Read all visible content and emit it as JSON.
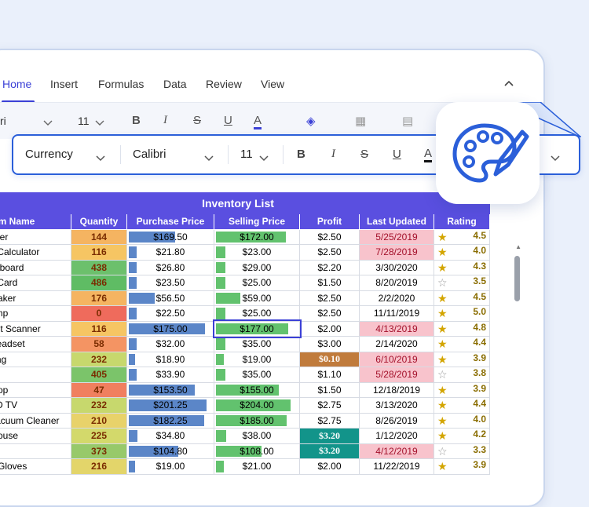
{
  "tabs": [
    {
      "label": "Home",
      "active": true
    },
    {
      "label": "Insert"
    },
    {
      "label": "Formulas"
    },
    {
      "label": "Data"
    },
    {
      "label": "Review"
    },
    {
      "label": "View"
    }
  ],
  "toolbar": {
    "font_clip": "ri",
    "size": "11"
  },
  "floating_toolbar": {
    "format": "Currency",
    "font": "Calibri",
    "size": "11"
  },
  "sheet": {
    "title": "Inventory List",
    "headers": [
      "tem Name",
      "Quantity",
      "Purchase Price",
      "Selling Price",
      "Profit",
      "Last Updated",
      "Rating"
    ],
    "rows": [
      {
        "name": "inter",
        "qty": "144",
        "qtyColor": "#f5b461",
        "pp": "$169.50",
        "ppFrac": 0.6,
        "sp": "$172.00",
        "spFrac": 0.92,
        "profit": "$2.50",
        "date": "5/25/2019",
        "dateColor": "#f8c3cc",
        "star": "full",
        "rating": "4.5"
      },
      {
        "name": "c Calculator",
        "qty": "116",
        "qtyColor": "#f6c563",
        "pp": "$21.80",
        "ppFrac": 0.1,
        "sp": "$23.00",
        "spFrac": 0.12,
        "profit": "$2.50",
        "date": "7/28/2019",
        "dateColor": "#f8c3cc",
        "star": "full",
        "rating": "4.0"
      },
      {
        "name": "eyboard",
        "qty": "438",
        "qtyColor": "#6cc06c",
        "pp": "$26.80",
        "ppFrac": 0.1,
        "sp": "$29.00",
        "spFrac": 0.12,
        "profit": "$2.20",
        "date": "3/30/2020",
        "dateColor": "",
        "star": "full",
        "rating": "4.3"
      },
      {
        "name": "y Card",
        "qty": "486",
        "qtyColor": "#5fbc64",
        "pp": "$23.50",
        "ppFrac": 0.1,
        "sp": "$25.00",
        "spFrac": 0.12,
        "profit": "$1.50",
        "date": "8/20/2019",
        "dateColor": "",
        "star": "empty",
        "rating": "3.5"
      },
      {
        "name": "Maker",
        "qty": "176",
        "qtyColor": "#f5b461",
        "pp": "$56.50",
        "ppFrac": 0.33,
        "sp": "$59.00",
        "spFrac": 0.32,
        "profit": "$2.50",
        "date": "2/2/2020",
        "dateColor": "",
        "star": "full",
        "rating": "4.5"
      },
      {
        "name": "amp",
        "qty": "0",
        "qtyColor": "#ef6b5c",
        "pp": "$22.50",
        "ppFrac": 0.1,
        "sp": "$25.00",
        "spFrac": 0.12,
        "profit": "$2.50",
        "date": "11/11/2019",
        "dateColor": "",
        "star": "full",
        "rating": "5.0"
      },
      {
        "name": "ent Scanner",
        "qty": "116",
        "qtyColor": "#f6c563",
        "pp": "$175.00",
        "ppFrac": 0.98,
        "sp": "$177.00",
        "spFrac": 0.95,
        "profit": "$2.00",
        "date": "4/13/2019",
        "dateColor": "#f8c3cc",
        "star": "full",
        "rating": "4.8"
      },
      {
        "name": "Headset",
        "qty": "58",
        "qtyColor": "#f49463",
        "pp": "$32.00",
        "ppFrac": 0.1,
        "sp": "$35.00",
        "spFrac": 0.12,
        "profit": "$3.00",
        "date": "2/14/2020",
        "dateColor": "",
        "star": "full",
        "rating": "4.4"
      },
      {
        "name": "Bag",
        "qty": "232",
        "qtyColor": "#c7d86d",
        "pp": "$18.90",
        "ppFrac": 0.08,
        "sp": "$19.00",
        "spFrac": 0.1,
        "profit": "$0.10",
        "profitColor": "#c07b3c",
        "date": "6/10/2019",
        "dateColor": "#f8c3cc",
        "star": "full",
        "rating": "3.9"
      },
      {
        "name": "an",
        "qty": "405",
        "qtyColor": "#7bc46a",
        "pp": "$33.90",
        "ppFrac": 0.1,
        "sp": "$35.00",
        "spFrac": 0.12,
        "profit": "$1.10",
        "date": "5/28/2019",
        "dateColor": "#f8c3cc",
        "star": "empty",
        "rating": "3.8"
      },
      {
        "name": "Mop",
        "qty": "47",
        "qtyColor": "#f07f5f",
        "pp": "$153.50",
        "ppFrac": 0.85,
        "sp": "$155.00",
        "spFrac": 0.82,
        "profit": "$1.50",
        "date": "12/18/2019",
        "dateColor": "",
        "star": "full",
        "rating": "3.9"
      },
      {
        "name": "ED TV",
        "qty": "232",
        "qtyColor": "#c7d86d",
        "pp": "$201.25",
        "ppFrac": 1.0,
        "sp": "$204.00",
        "spFrac": 0.98,
        "profit": "$2.75",
        "date": "3/13/2020",
        "dateColor": "",
        "star": "full",
        "rating": "4.4"
      },
      {
        "name": "Vacuum Cleaner",
        "qty": "210",
        "qtyColor": "#e8d26a",
        "pp": "$182.25",
        "ppFrac": 0.97,
        "sp": "$185.00",
        "spFrac": 0.93,
        "profit": "$2.75",
        "date": "8/26/2019",
        "dateColor": "",
        "star": "full",
        "rating": "4.0"
      },
      {
        "name": "Mouse",
        "qty": "225",
        "qtyColor": "#d3d96b",
        "pp": "$34.80",
        "ppFrac": 0.11,
        "sp": "$38.00",
        "spFrac": 0.13,
        "profit": "$3.20",
        "profitColor": "#12948a",
        "date": "1/12/2020",
        "dateColor": "",
        "star": "full",
        "rating": "4.2"
      },
      {
        "name": "",
        "qty": "373",
        "qtyColor": "#97c96a",
        "pp": "$104.80",
        "ppFrac": 0.64,
        "sp": "$108.00",
        "spFrac": 0.6,
        "profit": "$3.20",
        "profitColor": "#12948a",
        "date": "4/12/2019",
        "dateColor": "#f8c3cc",
        "star": "empty",
        "rating": "3.3"
      },
      {
        "name": "g Gloves",
        "qty": "216",
        "qtyColor": "#e3d56a",
        "pp": "$19.00",
        "ppFrac": 0.08,
        "sp": "$21.00",
        "spFrac": 0.1,
        "profit": "$2.00",
        "date": "11/22/2019",
        "dateColor": "",
        "star": "full",
        "rating": "3.9"
      }
    ]
  }
}
